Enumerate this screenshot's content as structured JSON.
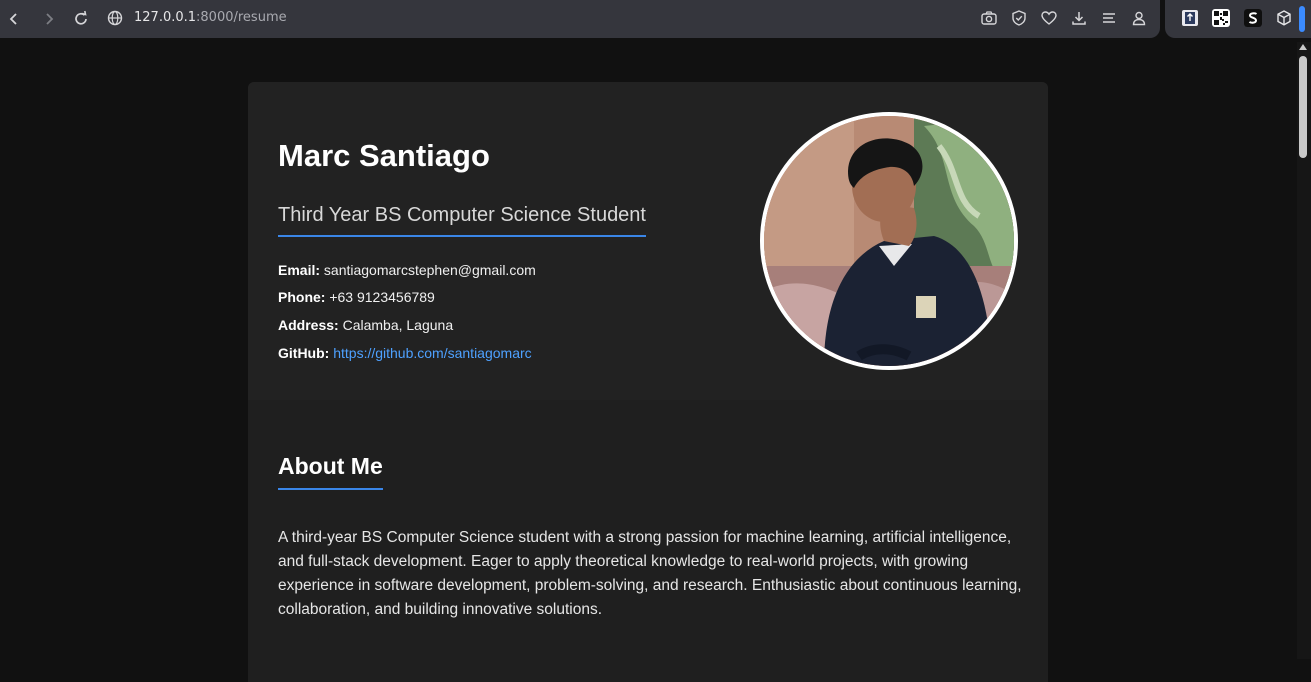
{
  "browser": {
    "url_host": "127.0.0.1",
    "url_rest": ":8000/resume",
    "back_icon": "chevron-left-icon",
    "forward_icon": "chevron-right-icon",
    "reload_icon": "reload-icon",
    "toolbar_icons": [
      "camera-icon",
      "shield-check-icon",
      "heart-icon",
      "download-icon",
      "menu-lines-icon",
      "profile-icon"
    ],
    "extension_icons": [
      "extension-upload-icon",
      "qr-code-icon",
      "extension-s-icon",
      "cube-icon"
    ]
  },
  "profile": {
    "name": "Marc Santiago",
    "subtitle": "Third Year BS Computer Science Student",
    "email_label": "Email:",
    "email": "santiagomarcstephen@gmail.com",
    "phone_label": "Phone:",
    "phone": "+63 9123456789",
    "address_label": "Address:",
    "address": "Calamba, Laguna",
    "github_label": "GitHub:",
    "github": "https://github.com/santiagomarc"
  },
  "about": {
    "title": "About Me",
    "text": "A third-year BS Computer Science student with a strong passion for machine learning, artificial intelligence, and full-stack development. Eager to apply theoretical knowledge to real-world projects, with growing experience in software development, problem-solving, and research. Enthusiastic about continuous learning, collaboration, and building innovative solutions."
  },
  "colors": {
    "accent": "#3a86e8",
    "link": "#4ea1ff",
    "page_bg": "#111111",
    "card_bg": "#222222"
  }
}
